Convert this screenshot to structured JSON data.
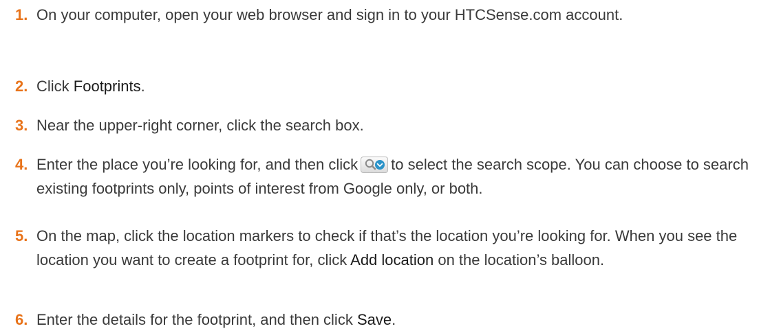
{
  "steps": [
    {
      "number": "1.",
      "text": "On your computer, open your web browser and sign in to your HTCSense.com account."
    },
    {
      "number": "2.",
      "pre": "Click ",
      "ui": "Footprints",
      "post": "."
    },
    {
      "number": "3.",
      "text": "Near the upper-right corner, click the search box."
    },
    {
      "number": "4.",
      "pre": "Enter the place you’re looking for, and then click",
      "post": "to select the search scope. You can choose to search existing footprints only, points of interest from Google only, or both.",
      "icon": "search-scope-icon"
    },
    {
      "number": "5.",
      "pre": "On the map, click the location markers to check if that’s the location you’re looking for. When you see the location you want to create a footprint for, click ",
      "ui": "Add location",
      "post": " on the location’s balloon."
    },
    {
      "number": "6.",
      "pre": "Enter the details for the footprint, and then click ",
      "ui": "Save",
      "post": "."
    }
  ],
  "colors": {
    "number": "#e8731a",
    "text": "#3a3a3a",
    "ui_term": "#1a1a1a",
    "icon": "#2b93c9"
  }
}
